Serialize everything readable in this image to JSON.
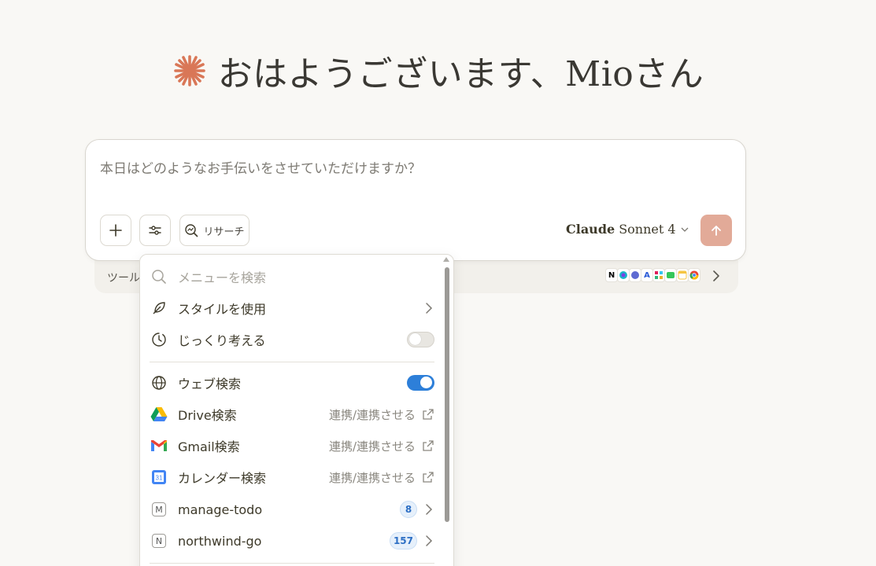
{
  "greeting": {
    "text": "おはようございます、Mioさん",
    "logo_color": "#d97757"
  },
  "composer": {
    "placeholder": "本日はどのようなお手伝いをさせていただけますか？",
    "research_label": "リサーチ",
    "model_brand": "Claude",
    "model_name": "Sonnet 4",
    "send_color": "#e2aa98"
  },
  "tools_strip": {
    "label": "ツールを",
    "connector_icons": [
      "notion-icon",
      "canva-icon",
      "linear-icon",
      "asana-icon",
      "slack-icon",
      "facetime-icon",
      "notes-icon",
      "chrome-icon"
    ]
  },
  "menu": {
    "search_placeholder": "メニューを検索",
    "items": [
      {
        "icon": "feather-icon",
        "label": "スタイルを使用",
        "right": "chevron"
      },
      {
        "icon": "timer-icon",
        "label": "じっくり考える",
        "right": "toggle",
        "toggle_on": false
      },
      {
        "icon": "globe-icon",
        "label": "ウェブ検索",
        "right": "toggle",
        "toggle_on": true
      },
      {
        "icon": "google-drive-icon",
        "label": "Drive検索",
        "right_text": "連携/連携させる",
        "right": "external"
      },
      {
        "icon": "gmail-icon",
        "label": "Gmail検索",
        "right_text": "連携/連携させる",
        "right": "external"
      },
      {
        "icon": "google-calendar-icon",
        "label": "カレンダー検索",
        "right_text": "連携/連携させる",
        "right": "external"
      },
      {
        "icon": "letter-m-icon",
        "letter": "M",
        "label": "manage-todo",
        "badge": "8",
        "right": "chevron"
      },
      {
        "icon": "letter-n-icon",
        "letter": "N",
        "label": "northwind-go",
        "badge": "157",
        "right": "chevron"
      }
    ],
    "calendar_day": "31"
  },
  "colors": {
    "toggle_on": "#2d7fd9",
    "background": "#f9f8f5",
    "accent": "#d97757"
  }
}
